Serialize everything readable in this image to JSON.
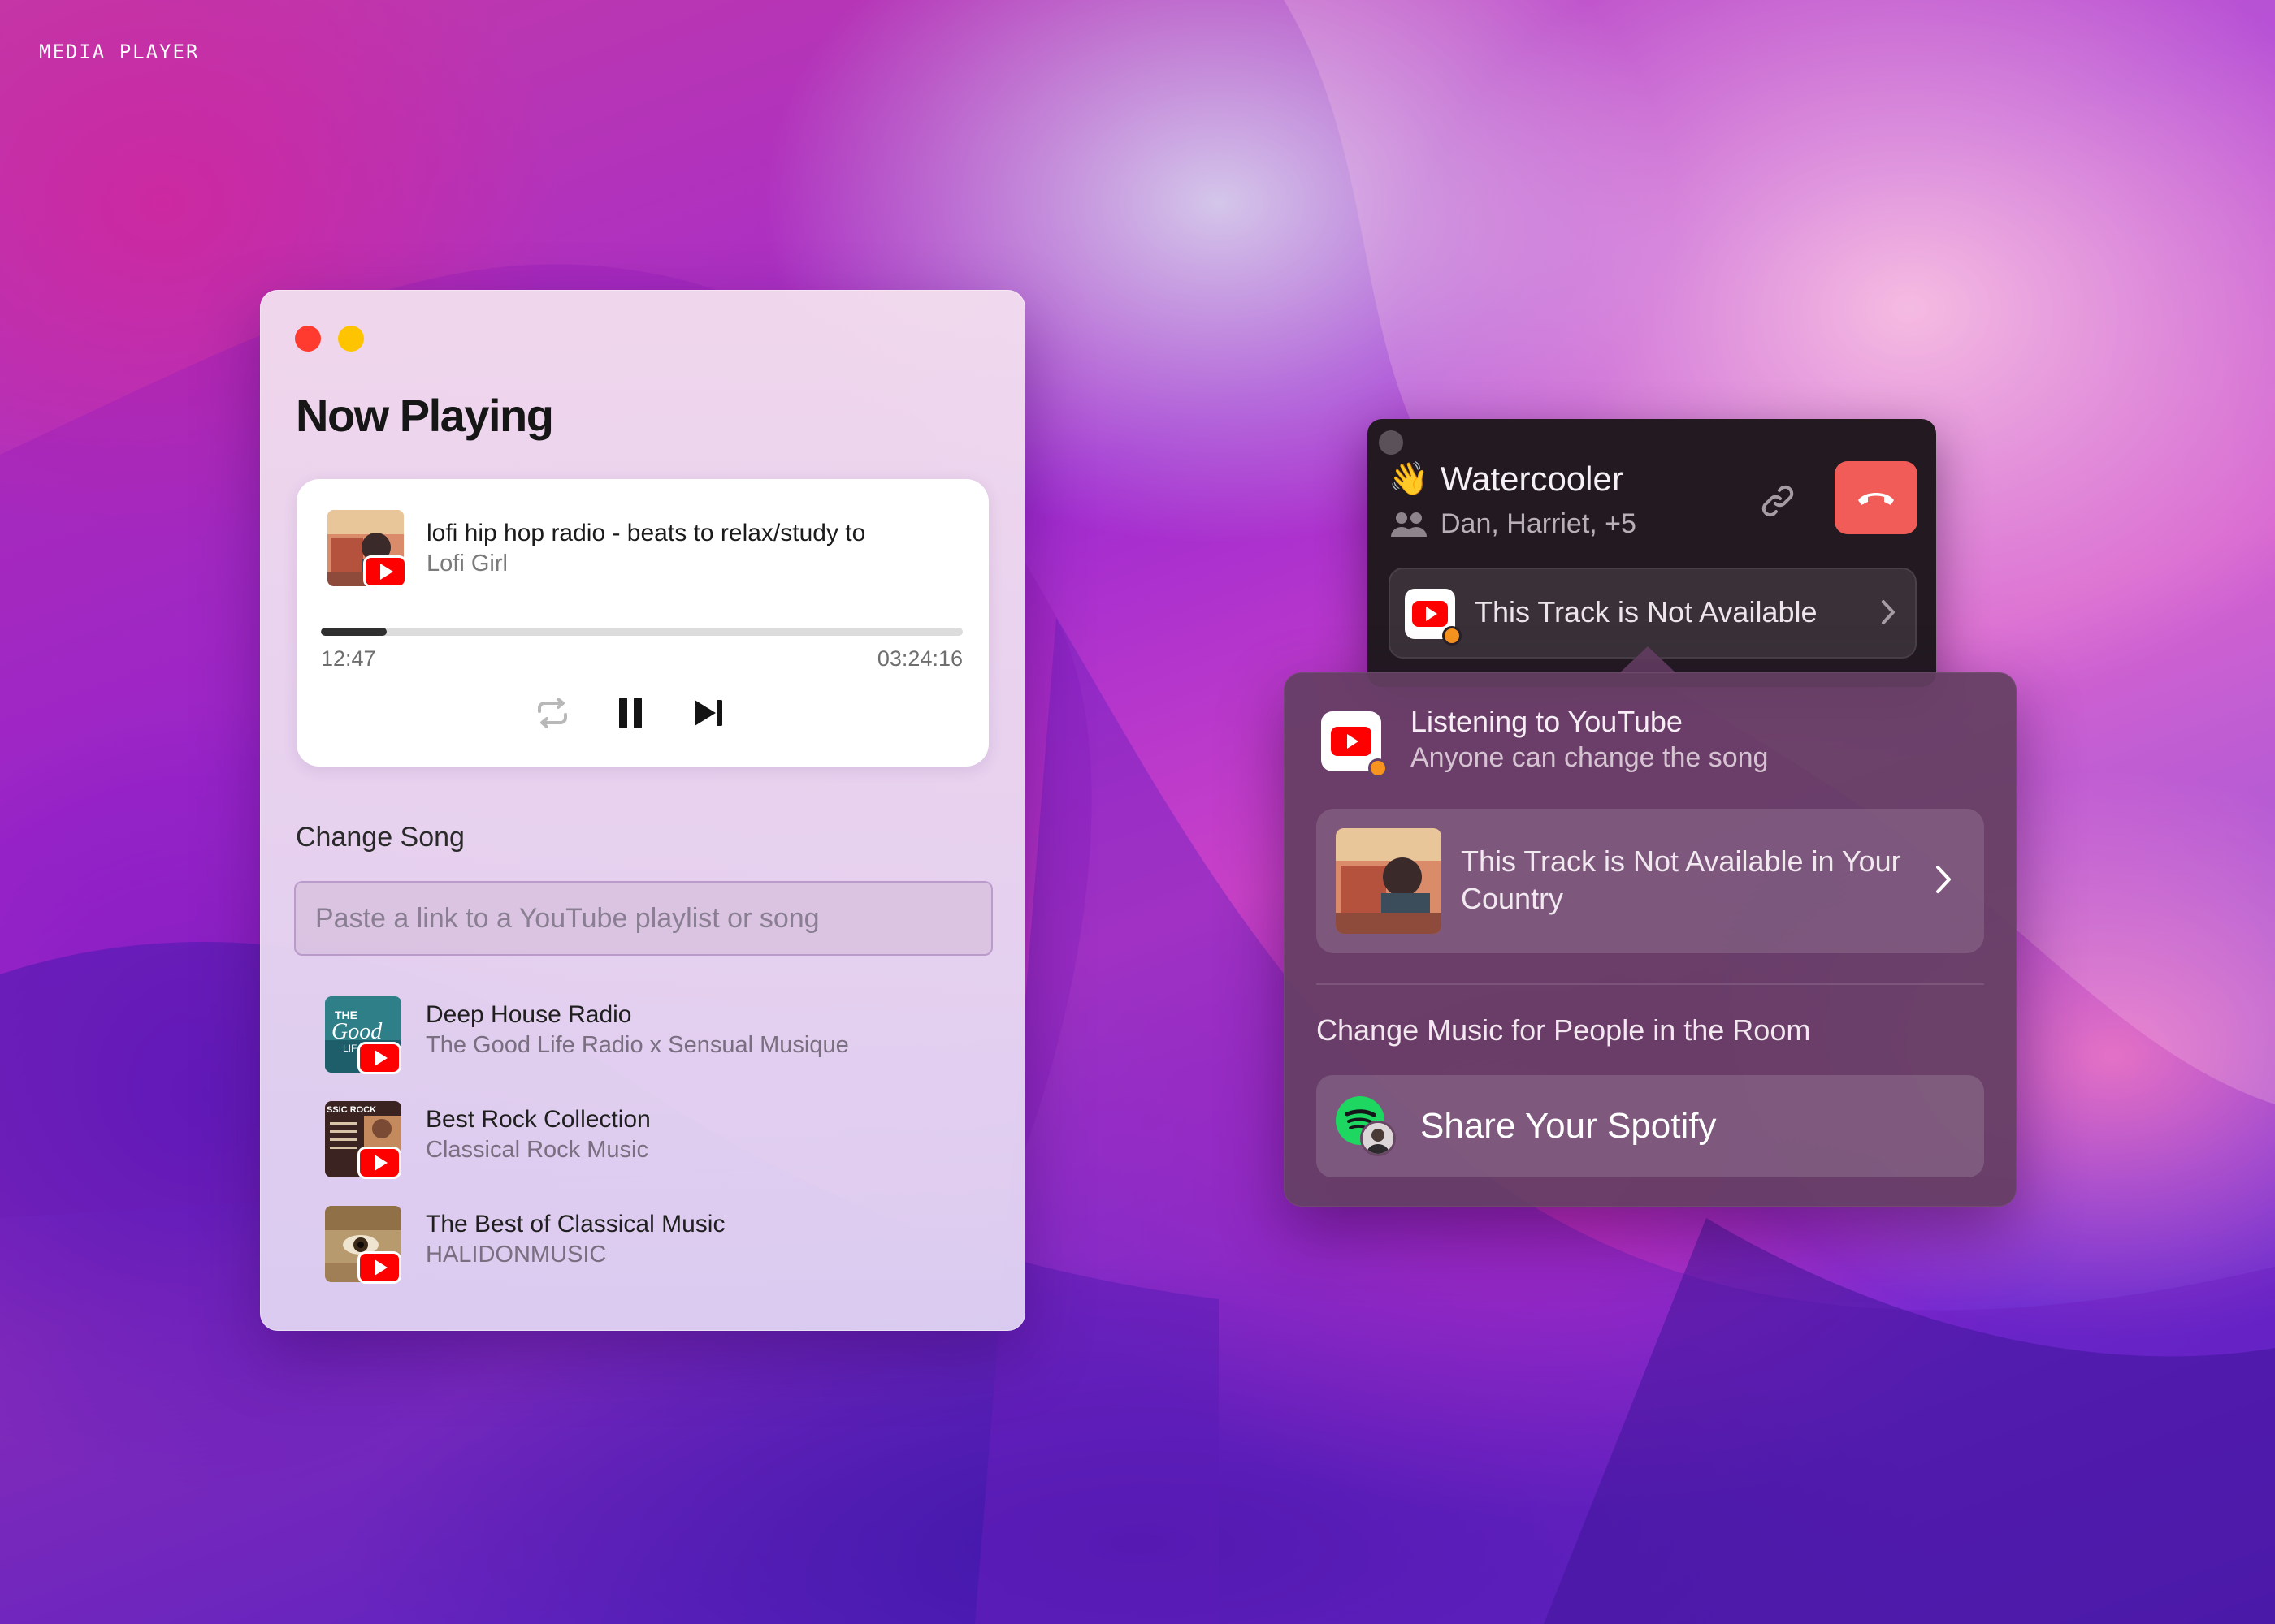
{
  "desktop": {
    "corner_label": "MEDIA PLAYER"
  },
  "now_playing": {
    "title": "Now Playing",
    "track": {
      "title": "lofi hip hop radio - beats to relax/study to",
      "artist": "Lofi Girl",
      "elapsed": "12:47",
      "duration": "03:24:16",
      "progress": 0.103
    },
    "controls": {
      "repeat_icon": "repeat-icon",
      "pause_icon": "pause-icon",
      "next_icon": "skip-next-icon"
    },
    "change_song": {
      "label": "Change Song",
      "placeholder": "Paste a link to a YouTube playlist or song",
      "value": ""
    },
    "playlists": [
      {
        "title": "Deep House Radio",
        "subtitle": "The Good Life Radio x Sensual Musique"
      },
      {
        "title": "Best Rock Collection",
        "subtitle": "Classical Rock Music"
      },
      {
        "title": "The Best of Classical Music",
        "subtitle": "HALIDONMUSIC"
      }
    ],
    "art_text": {
      "good_life_1": "THE",
      "good_life_2": "Good",
      "good_life_3": "LIF",
      "rock": "SSIC ROCK"
    }
  },
  "watercooler": {
    "emoji": "👋",
    "title": "Watercooler",
    "participants": "Dan, Harriet, +5",
    "link_icon": "link-icon",
    "hangup_icon": "hang-up-icon",
    "track_row_label": "This Track is Not Available"
  },
  "youtube_popover": {
    "title": "Listening to YouTube",
    "subtitle": "Anyone can change the song",
    "track_message": "This Track is Not Available in Your Country",
    "section_label": "Change Music for People in the Room",
    "spotify_button": "Share Your Spotify"
  },
  "colors": {
    "youtube_red": "#ff0000",
    "hangup_red": "#f25c58",
    "status_orange": "#f7931e",
    "spotify_green": "#1ed760"
  }
}
